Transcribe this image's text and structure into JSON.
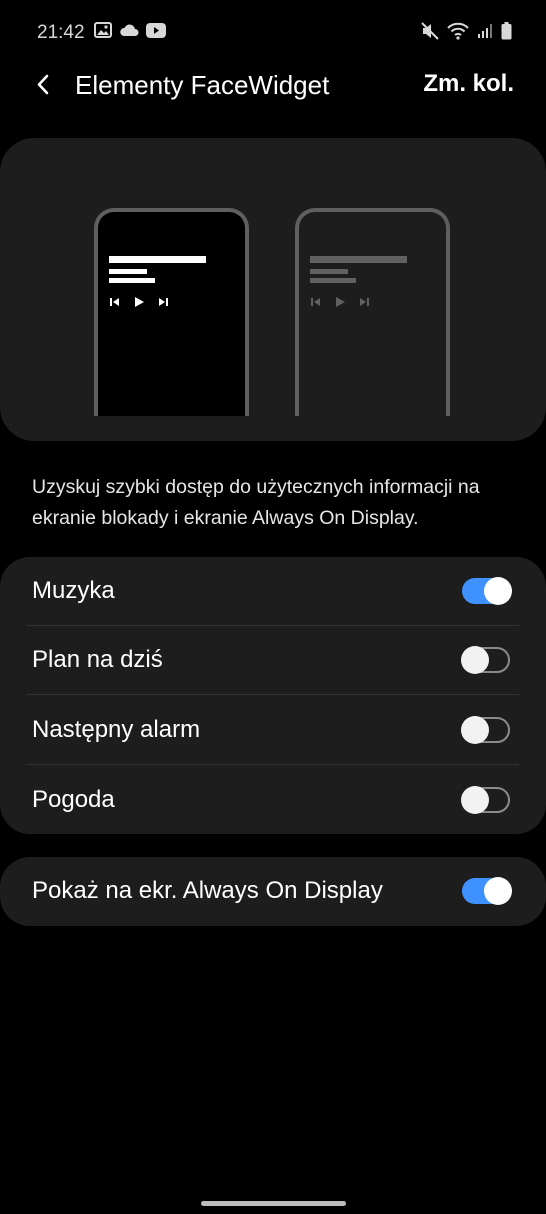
{
  "status_bar": {
    "time": "21:42",
    "left_icons": [
      "image-icon",
      "cloud-icon",
      "youtube-icon"
    ],
    "right_icons": [
      "mute-icon",
      "wifi-icon",
      "signal-icon",
      "battery-icon"
    ]
  },
  "header": {
    "back_icon": "back-arrow-icon",
    "title": "Elementy FaceWidget",
    "action_label": "Zm. kol."
  },
  "preview": {
    "phones": [
      "dark",
      "light"
    ],
    "controls": [
      "previous-icon",
      "play-icon",
      "next-icon"
    ]
  },
  "description": "Uzyskuj szybki dostęp do użytecznych informacji na ekranie blokady i ekranie Always On Display.",
  "items": [
    {
      "label": "Muzyka",
      "on": true
    },
    {
      "label": "Plan na dziś",
      "on": false
    },
    {
      "label": "Następny alarm",
      "on": false
    },
    {
      "label": "Pogoda",
      "on": false
    }
  ],
  "aod": {
    "label": "Pokaż na ekr. Always On Display",
    "on": true
  },
  "colors": {
    "accent": "#3e91ff",
    "card": "#1d1d1d",
    "background": "#000000"
  }
}
